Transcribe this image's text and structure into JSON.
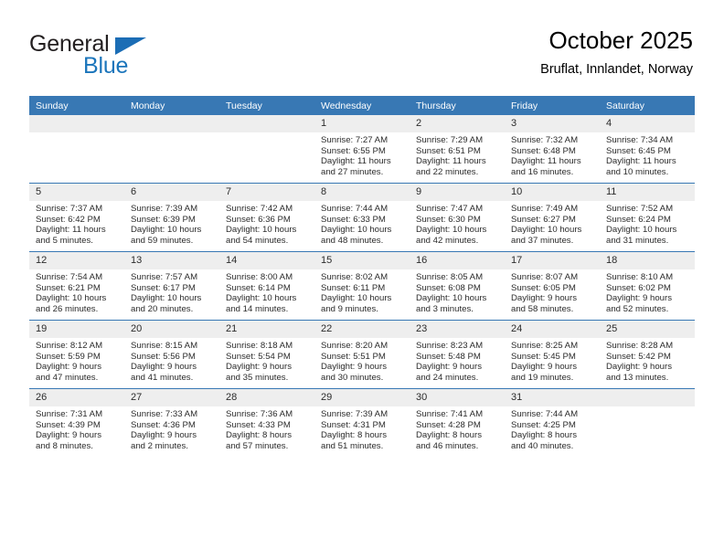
{
  "brand": {
    "word_one": "General",
    "word_two": "Blue",
    "triangle_icon": "triangle-icon",
    "accent_color": "#1b75bb"
  },
  "header": {
    "title": "October 2025",
    "subtitle": "Bruflat, Innlandet, Norway"
  },
  "calendar": {
    "header_color": "#3878b4",
    "daynum_bg": "#eeeeee",
    "weekdays": [
      "Sunday",
      "Monday",
      "Tuesday",
      "Wednesday",
      "Thursday",
      "Friday",
      "Saturday"
    ],
    "weeks": [
      [
        {
          "day": "",
          "sunrise": "",
          "sunset": "",
          "daylight_line1": "",
          "daylight_line2": ""
        },
        {
          "day": "",
          "sunrise": "",
          "sunset": "",
          "daylight_line1": "",
          "daylight_line2": ""
        },
        {
          "day": "",
          "sunrise": "",
          "sunset": "",
          "daylight_line1": "",
          "daylight_line2": ""
        },
        {
          "day": "1",
          "sunrise": "Sunrise: 7:27 AM",
          "sunset": "Sunset: 6:55 PM",
          "daylight_line1": "Daylight: 11 hours",
          "daylight_line2": "and 27 minutes."
        },
        {
          "day": "2",
          "sunrise": "Sunrise: 7:29 AM",
          "sunset": "Sunset: 6:51 PM",
          "daylight_line1": "Daylight: 11 hours",
          "daylight_line2": "and 22 minutes."
        },
        {
          "day": "3",
          "sunrise": "Sunrise: 7:32 AM",
          "sunset": "Sunset: 6:48 PM",
          "daylight_line1": "Daylight: 11 hours",
          "daylight_line2": "and 16 minutes."
        },
        {
          "day": "4",
          "sunrise": "Sunrise: 7:34 AM",
          "sunset": "Sunset: 6:45 PM",
          "daylight_line1": "Daylight: 11 hours",
          "daylight_line2": "and 10 minutes."
        }
      ],
      [
        {
          "day": "5",
          "sunrise": "Sunrise: 7:37 AM",
          "sunset": "Sunset: 6:42 PM",
          "daylight_line1": "Daylight: 11 hours",
          "daylight_line2": "and 5 minutes."
        },
        {
          "day": "6",
          "sunrise": "Sunrise: 7:39 AM",
          "sunset": "Sunset: 6:39 PM",
          "daylight_line1": "Daylight: 10 hours",
          "daylight_line2": "and 59 minutes."
        },
        {
          "day": "7",
          "sunrise": "Sunrise: 7:42 AM",
          "sunset": "Sunset: 6:36 PM",
          "daylight_line1": "Daylight: 10 hours",
          "daylight_line2": "and 54 minutes."
        },
        {
          "day": "8",
          "sunrise": "Sunrise: 7:44 AM",
          "sunset": "Sunset: 6:33 PM",
          "daylight_line1": "Daylight: 10 hours",
          "daylight_line2": "and 48 minutes."
        },
        {
          "day": "9",
          "sunrise": "Sunrise: 7:47 AM",
          "sunset": "Sunset: 6:30 PM",
          "daylight_line1": "Daylight: 10 hours",
          "daylight_line2": "and 42 minutes."
        },
        {
          "day": "10",
          "sunrise": "Sunrise: 7:49 AM",
          "sunset": "Sunset: 6:27 PM",
          "daylight_line1": "Daylight: 10 hours",
          "daylight_line2": "and 37 minutes."
        },
        {
          "day": "11",
          "sunrise": "Sunrise: 7:52 AM",
          "sunset": "Sunset: 6:24 PM",
          "daylight_line1": "Daylight: 10 hours",
          "daylight_line2": "and 31 minutes."
        }
      ],
      [
        {
          "day": "12",
          "sunrise": "Sunrise: 7:54 AM",
          "sunset": "Sunset: 6:21 PM",
          "daylight_line1": "Daylight: 10 hours",
          "daylight_line2": "and 26 minutes."
        },
        {
          "day": "13",
          "sunrise": "Sunrise: 7:57 AM",
          "sunset": "Sunset: 6:17 PM",
          "daylight_line1": "Daylight: 10 hours",
          "daylight_line2": "and 20 minutes."
        },
        {
          "day": "14",
          "sunrise": "Sunrise: 8:00 AM",
          "sunset": "Sunset: 6:14 PM",
          "daylight_line1": "Daylight: 10 hours",
          "daylight_line2": "and 14 minutes."
        },
        {
          "day": "15",
          "sunrise": "Sunrise: 8:02 AM",
          "sunset": "Sunset: 6:11 PM",
          "daylight_line1": "Daylight: 10 hours",
          "daylight_line2": "and 9 minutes."
        },
        {
          "day": "16",
          "sunrise": "Sunrise: 8:05 AM",
          "sunset": "Sunset: 6:08 PM",
          "daylight_line1": "Daylight: 10 hours",
          "daylight_line2": "and 3 minutes."
        },
        {
          "day": "17",
          "sunrise": "Sunrise: 8:07 AM",
          "sunset": "Sunset: 6:05 PM",
          "daylight_line1": "Daylight: 9 hours",
          "daylight_line2": "and 58 minutes."
        },
        {
          "day": "18",
          "sunrise": "Sunrise: 8:10 AM",
          "sunset": "Sunset: 6:02 PM",
          "daylight_line1": "Daylight: 9 hours",
          "daylight_line2": "and 52 minutes."
        }
      ],
      [
        {
          "day": "19",
          "sunrise": "Sunrise: 8:12 AM",
          "sunset": "Sunset: 5:59 PM",
          "daylight_line1": "Daylight: 9 hours",
          "daylight_line2": "and 47 minutes."
        },
        {
          "day": "20",
          "sunrise": "Sunrise: 8:15 AM",
          "sunset": "Sunset: 5:56 PM",
          "daylight_line1": "Daylight: 9 hours",
          "daylight_line2": "and 41 minutes."
        },
        {
          "day": "21",
          "sunrise": "Sunrise: 8:18 AM",
          "sunset": "Sunset: 5:54 PM",
          "daylight_line1": "Daylight: 9 hours",
          "daylight_line2": "and 35 minutes."
        },
        {
          "day": "22",
          "sunrise": "Sunrise: 8:20 AM",
          "sunset": "Sunset: 5:51 PM",
          "daylight_line1": "Daylight: 9 hours",
          "daylight_line2": "and 30 minutes."
        },
        {
          "day": "23",
          "sunrise": "Sunrise: 8:23 AM",
          "sunset": "Sunset: 5:48 PM",
          "daylight_line1": "Daylight: 9 hours",
          "daylight_line2": "and 24 minutes."
        },
        {
          "day": "24",
          "sunrise": "Sunrise: 8:25 AM",
          "sunset": "Sunset: 5:45 PM",
          "daylight_line1": "Daylight: 9 hours",
          "daylight_line2": "and 19 minutes."
        },
        {
          "day": "25",
          "sunrise": "Sunrise: 8:28 AM",
          "sunset": "Sunset: 5:42 PM",
          "daylight_line1": "Daylight: 9 hours",
          "daylight_line2": "and 13 minutes."
        }
      ],
      [
        {
          "day": "26",
          "sunrise": "Sunrise: 7:31 AM",
          "sunset": "Sunset: 4:39 PM",
          "daylight_line1": "Daylight: 9 hours",
          "daylight_line2": "and 8 minutes."
        },
        {
          "day": "27",
          "sunrise": "Sunrise: 7:33 AM",
          "sunset": "Sunset: 4:36 PM",
          "daylight_line1": "Daylight: 9 hours",
          "daylight_line2": "and 2 minutes."
        },
        {
          "day": "28",
          "sunrise": "Sunrise: 7:36 AM",
          "sunset": "Sunset: 4:33 PM",
          "daylight_line1": "Daylight: 8 hours",
          "daylight_line2": "and 57 minutes."
        },
        {
          "day": "29",
          "sunrise": "Sunrise: 7:39 AM",
          "sunset": "Sunset: 4:31 PM",
          "daylight_line1": "Daylight: 8 hours",
          "daylight_line2": "and 51 minutes."
        },
        {
          "day": "30",
          "sunrise": "Sunrise: 7:41 AM",
          "sunset": "Sunset: 4:28 PM",
          "daylight_line1": "Daylight: 8 hours",
          "daylight_line2": "and 46 minutes."
        },
        {
          "day": "31",
          "sunrise": "Sunrise: 7:44 AM",
          "sunset": "Sunset: 4:25 PM",
          "daylight_line1": "Daylight: 8 hours",
          "daylight_line2": "and 40 minutes."
        },
        {
          "day": "",
          "sunrise": "",
          "sunset": "",
          "daylight_line1": "",
          "daylight_line2": ""
        }
      ]
    ]
  }
}
